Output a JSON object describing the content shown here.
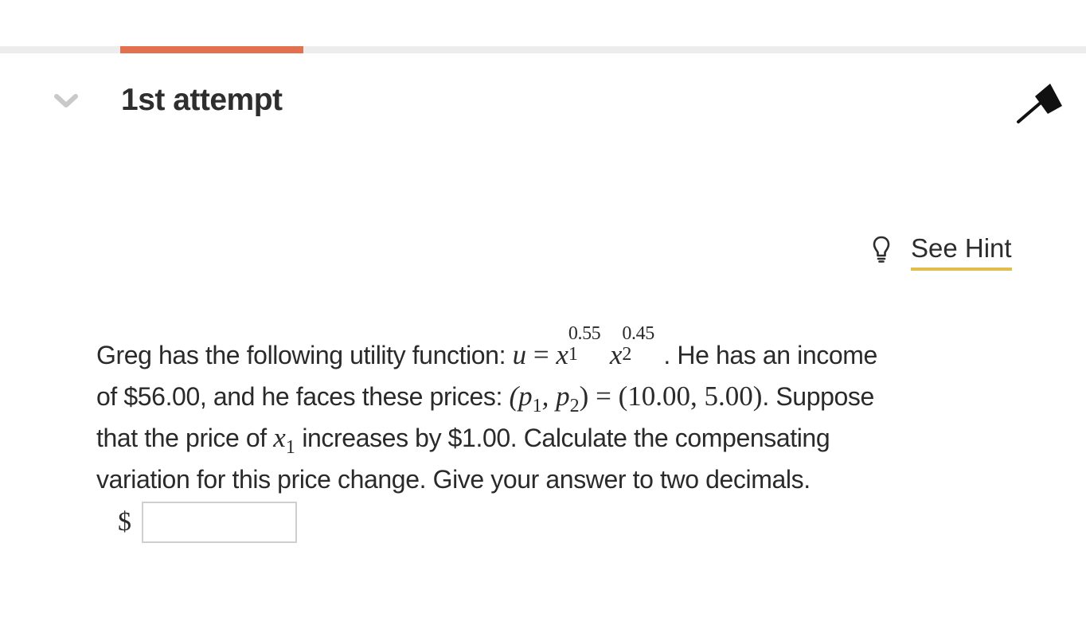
{
  "progress": {
    "fraction": 0.17,
    "color": "#e3704f"
  },
  "attempt": {
    "title": "1st attempt"
  },
  "icons": {
    "collapse": "chevron-down-icon",
    "flag": "flag-icon",
    "hint": "lightbulb-icon"
  },
  "hint": {
    "label": "See Hint"
  },
  "question": {
    "intro": "Greg has the following utility function:",
    "u": "u",
    "eq": "=",
    "x": "x",
    "exp1": "0.55",
    "sub1": "1",
    "exp2": "0.45",
    "sub2": "2",
    "after_utility": ". He has an income",
    "line2_start": "of $56.00, and he faces these prices:",
    "prices_vars": "(p",
    "comma": ", p",
    "close": ")",
    "prices_values": "(10.00, 5.00)",
    "line2_end": ". Suppose",
    "line3_start": "that the price of",
    "line3_end": "increases by $1.00. Calculate the compensating",
    "line4": "variation for this price change. Give your answer to two decimals."
  },
  "answer": {
    "currency": "$",
    "value": ""
  }
}
